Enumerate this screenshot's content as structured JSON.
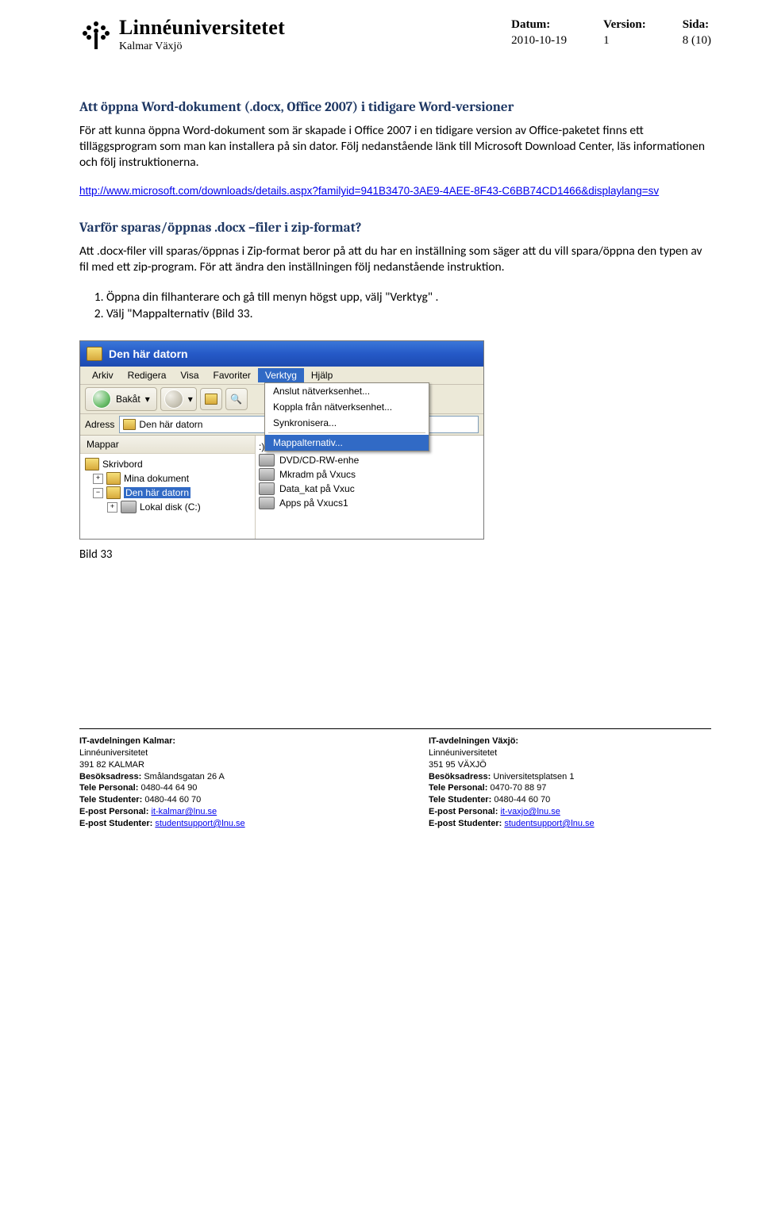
{
  "header": {
    "logo_main": "Linnéuniversitetet",
    "logo_sub": "Kalmar Växjö",
    "meta": {
      "datum_label": "Datum:",
      "datum_value": "2010-10-19",
      "version_label": "Version:",
      "version_value": "1",
      "sida_label": "Sida:",
      "sida_value": "8 (10)"
    }
  },
  "section1": {
    "title": "Att öppna Word-dokument (.docx, Office 2007) i tidigare Word-versioner",
    "body": "För att kunna öppna Word-dokument som är skapade i Office 2007 i en tidigare version av Office-paketet finns ett tilläggsprogram som man kan installera på sin dator. Följ nedanstående länk till Microsoft Download Center, läs informationen och följ instruktionerna.",
    "link": "http://www.microsoft.com/downloads/details.aspx?familyid=941B3470-3AE9-4AEE-8F43-C6BB74CD1466&displaylang=sv"
  },
  "section2": {
    "title": "Varför sparas/öppnas .docx –filer i zip-format?",
    "body": "Att .docx-filer vill sparas/öppnas i Zip-format beror på att du har en inställning som säger att du vill spara/öppna den typen av fil med ett zip-program. För att ändra den inställningen följ nedanstående instruktion.",
    "step1": "Öppna din filhanterare och gå till menyn högst upp, välj \"Verktyg\" .",
    "step2": "Välj \"Mappalternativ (Bild 33."
  },
  "screenshot": {
    "title": "Den här datorn",
    "menu": [
      "Arkiv",
      "Redigera",
      "Visa",
      "Favoriter",
      "Verktyg",
      "Hjälp"
    ],
    "dropdown": [
      "Anslut nätverksenhet...",
      "Koppla från nätverksenhet...",
      "Synkronisera...",
      "Mappalternativ..."
    ],
    "back_label": "Bakåt",
    "addr_label": "Adress",
    "addr_value": "Den här datorn",
    "pane_header": "Mappar",
    "tree": {
      "skrivbord": "Skrivbord",
      "mina": "Mina dokument",
      "den": "Den här datorn",
      "lokal": "Lokal disk (C:)"
    },
    "right": [
      ":)",
      "DVD/CD-RW-enhe",
      "Mkradm på Vxucs",
      "Data_kat på Vxuc",
      "Apps på Vxucs1"
    ]
  },
  "caption": "Bild 33",
  "footer": {
    "left": {
      "h": "IT-avdelningen Kalmar:",
      "line1": "Linnéuniversitetet",
      "line2": "391 82 KALMAR",
      "besok_l": "Besöksadress:",
      "besok_v": " Smålandsgatan 26 A",
      "telp_l": "Tele Personal:",
      "telp_v": " 0480-44 64 90",
      "tels_l": "Tele Studenter:",
      "tels_v": " 0480-44 60 70",
      "ep_p_l": "E-post Personal: ",
      "ep_p_v": "it-kalmar@lnu.se",
      "ep_s_l": "E-post Studenter: ",
      "ep_s_v": "studentsupport@lnu.se"
    },
    "right": {
      "h": "IT-avdelningen Växjö:",
      "line1": "Linnéuniversitetet",
      "line2": "351 95 VÄXJÖ",
      "besok_l": "Besöksadress:",
      "besok_v": " Universitetsplatsen 1",
      "telp_l": "Tele Personal:",
      "telp_v": " 0470-70 88 97",
      "tels_l": "Tele Studenter:",
      "tels_v": " 0480-44 60 70",
      "ep_p_l": "E-post Personal: ",
      "ep_p_v": "it-vaxjo@lnu.se",
      "ep_s_l": "E-post Studenter: ",
      "ep_s_v": "studentsupport@lnu.se"
    }
  }
}
